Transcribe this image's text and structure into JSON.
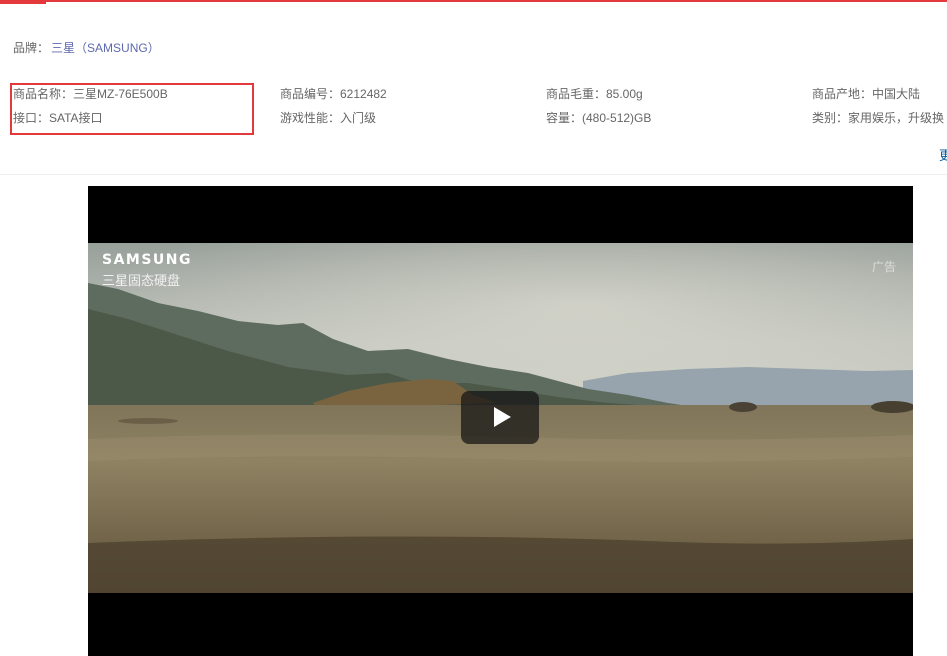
{
  "brand": {
    "label": "品牌：",
    "value": "三星（SAMSUNG）"
  },
  "params": [
    [
      "商品名称：三星MZ-76E500B",
      "商品编号：6212482",
      "商品毛重：85.00g",
      "商品产地：中国大陆"
    ],
    [
      "接口：SATA接口",
      "游戏性能：入门级",
      "容量：(480-512)GB",
      "类别：家用娱乐，升级换"
    ]
  ],
  "more_link": "更",
  "video": {
    "logo": "SAMSUNG",
    "subtitle": "三星固态硬盘",
    "ad_label": "广告",
    "play_icon": "play-icon"
  },
  "colors": {
    "accent": "#e4393c",
    "brand_link": "#5e69ad",
    "more_link": "#005aa0"
  }
}
